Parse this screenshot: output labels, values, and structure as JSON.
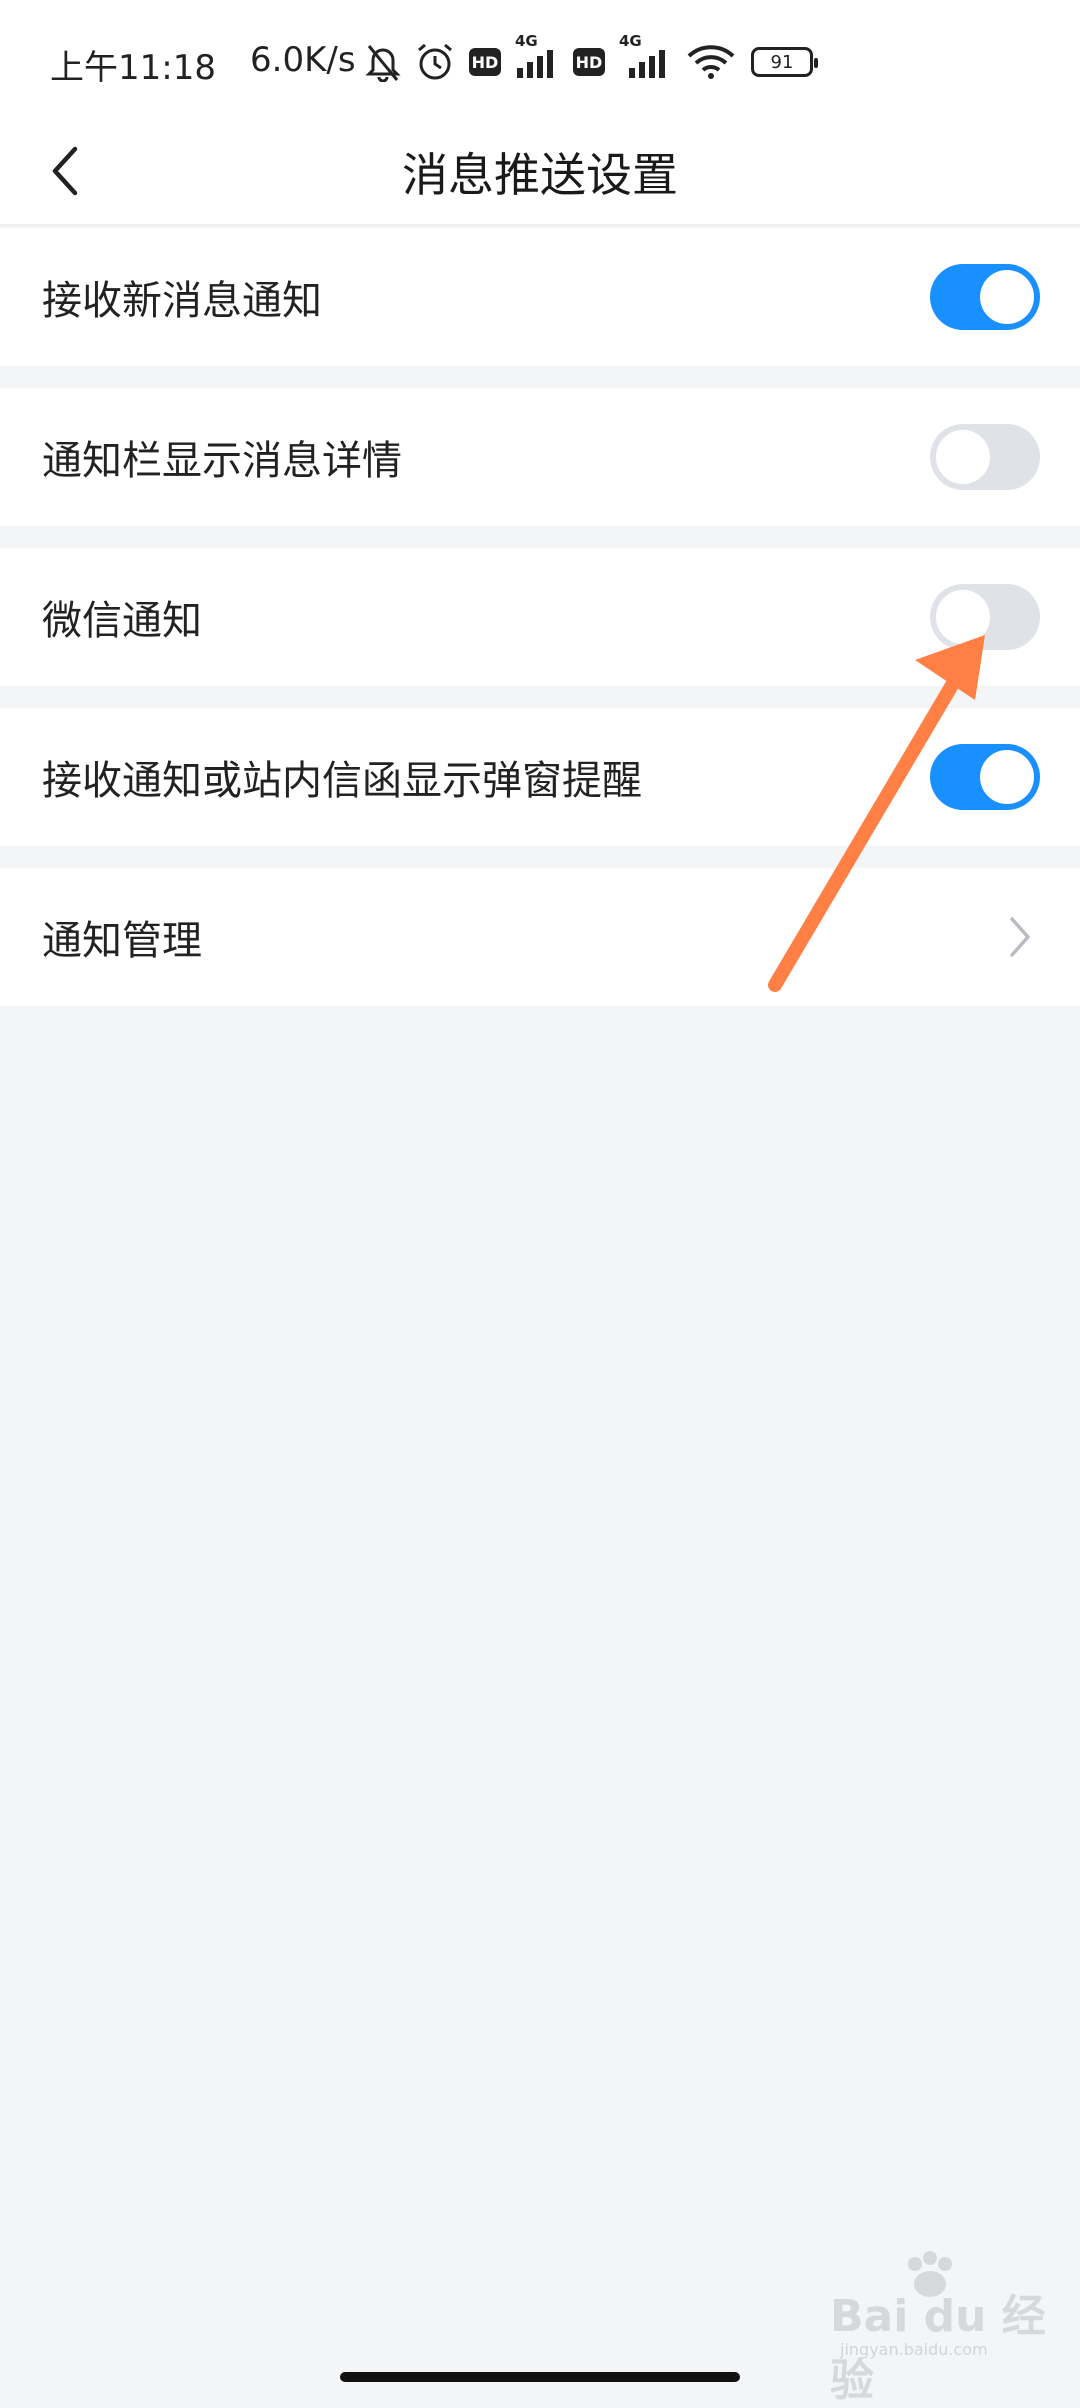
{
  "status_bar": {
    "time": "上午11:18",
    "net_speed": "6.0K/s",
    "hd_label": "HD",
    "network_1": "4G",
    "network_2": "4G",
    "battery": "91",
    "icons": [
      "mute-bell-icon",
      "alarm-icon",
      "hd-icon",
      "signal-icon",
      "hd-icon",
      "signal-icon",
      "wifi-icon",
      "battery-icon"
    ]
  },
  "nav": {
    "title": "消息推送设置",
    "back_icon": "chevron-left-icon"
  },
  "settings": [
    {
      "label": "接收新消息通知",
      "state": "on"
    },
    {
      "label": "通知栏显示消息详情",
      "state": "off"
    },
    {
      "label": "微信通知",
      "state": "off"
    },
    {
      "label": "接收通知或站内信函显示弹窗提醒",
      "state": "on"
    },
    {
      "label": "通知管理",
      "type": "link"
    }
  ],
  "colors": {
    "accent": "#1890ff",
    "toggle_off": "#dfe2e7",
    "background": "#f4f5f7",
    "annotation": "#ff7f45"
  },
  "watermark": {
    "brand": "Bai du 经验",
    "url": "jingyan.baidu.com"
  }
}
